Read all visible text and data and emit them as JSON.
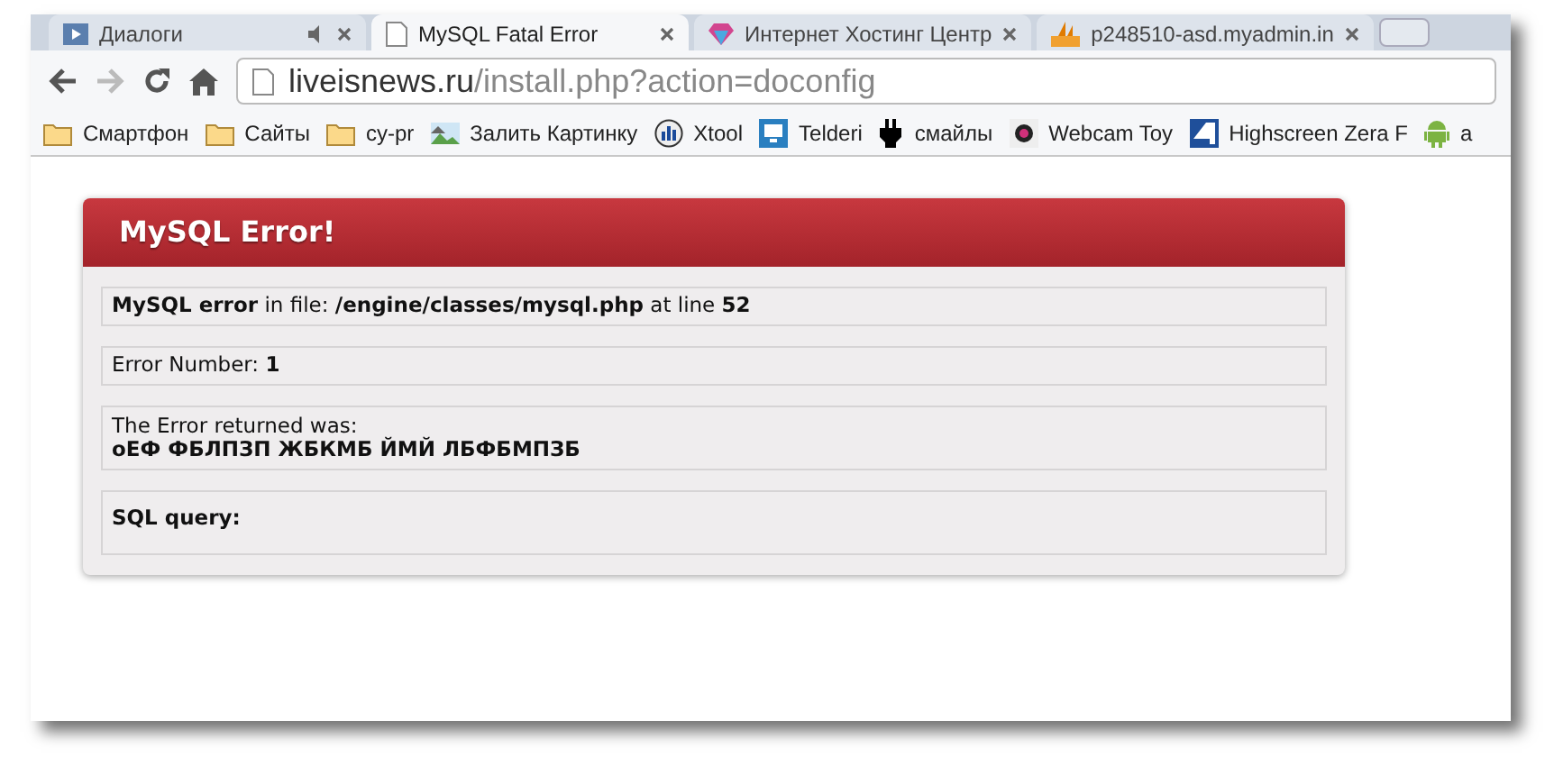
{
  "tabs": [
    {
      "label": "Диалоги",
      "selected": false
    },
    {
      "label": "MySQL Fatal Error",
      "selected": true
    },
    {
      "label": "Интернет Хостинг Центр",
      "selected": false
    },
    {
      "label": "p248510-asd.myadmin.in",
      "selected": false
    }
  ],
  "address": {
    "host": "liveisnews.ru",
    "path": "/install.php?action=doconfig"
  },
  "bookmarks": [
    {
      "label": "Смартфон"
    },
    {
      "label": "Сайты"
    },
    {
      "label": "cy-pr"
    },
    {
      "label": "Залить Картинку"
    },
    {
      "label": "Xtool"
    },
    {
      "label": "Telderi"
    },
    {
      "label": "смайлы"
    },
    {
      "label": "Webcam Toy"
    },
    {
      "label": "Highscreen Zera F"
    },
    {
      "label": "a"
    }
  ],
  "error": {
    "title": "MySQL Error!",
    "rows": [
      {
        "kind": "line",
        "text": "**MySQL error** in file: **/engine/classes/mysql.php** at line **52**"
      },
      {
        "kind": "line",
        "text": "Error Number: **1**"
      },
      {
        "kind": "returned",
        "label": "The Error returned was:",
        "message": "оЕФ ФБЛПЗП ЖБКМБ ЙМЙ ЛБФБМПЗБ"
      },
      {
        "kind": "query",
        "label": "SQL query:"
      }
    ]
  }
}
